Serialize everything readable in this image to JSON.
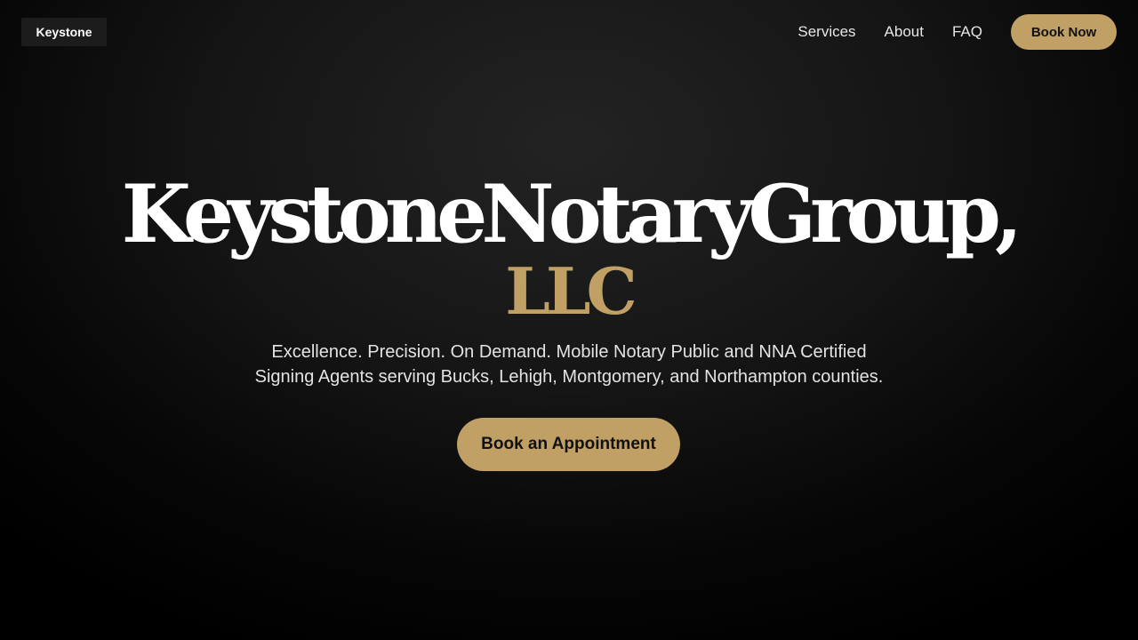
{
  "header": {
    "logo_text": "Keystone",
    "nav": {
      "services": "Services",
      "about": "About",
      "faq": "FAQ"
    },
    "book_now_label": "Book Now"
  },
  "hero": {
    "title": "KeystoneNotaryGroup,",
    "title_suffix": "LLC",
    "tagline_line1": "Excellence. Precision. On Demand. Mobile Notary Public and NNA Certified",
    "tagline_line2": "Signing Agents serving Bucks, Lehigh, Montgomery, and Northampton counties.",
    "cta_label": "Book an Appointment"
  },
  "colors": {
    "accent": "#c0a064",
    "background": "#000000",
    "text": "#ffffff"
  }
}
